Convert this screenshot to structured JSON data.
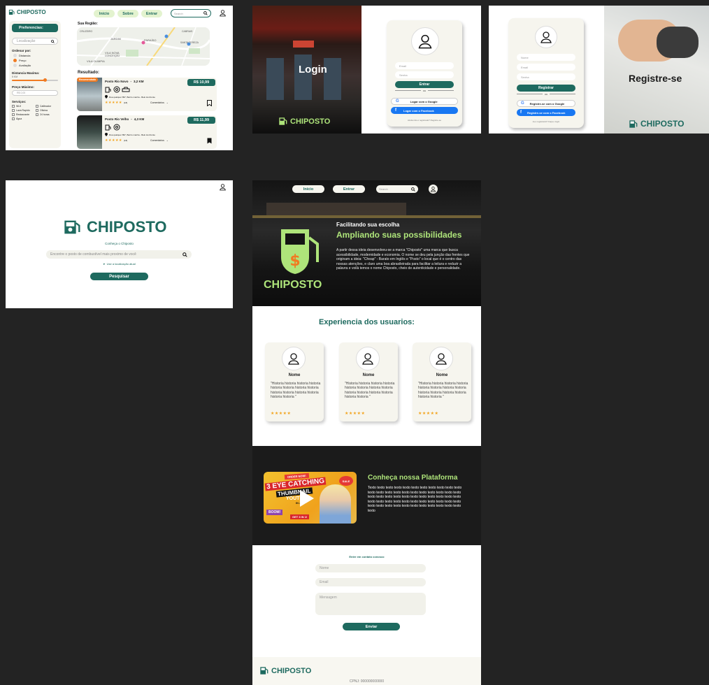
{
  "brand": "CHIPOSTO",
  "search_page": {
    "nav": [
      "Início",
      "Sobre",
      "Entrar"
    ],
    "search_placeholder": "Search",
    "prefs_title": "Preferencias:",
    "location_placeholder": "Localização",
    "sort_title": "Ordenar por:",
    "sort_options": [
      "Distancia",
      "Preço",
      "Avaliação"
    ],
    "distance_title": "Distancia Maxima:",
    "distance_value": "5 KM",
    "price_title": "Preço Máximo:",
    "price_placeholder": "R$ 0,00",
    "services_title": "Serviços:",
    "services": [
      "Wi-fi",
      "Calibrador",
      "Lava Rapido",
      "Oficina",
      "Restaurante",
      "24 horas",
      "Água"
    ],
    "region_title": "Sua Região:",
    "map_labels": [
      "CRUZEIRO",
      "JARDIM",
      "PARAÍSO",
      "SANTA TEREZA",
      "VILA NOVA",
      "CONCEIÇÃO",
      "VILA OLIMPIA",
      "CABRAIS"
    ],
    "results_title": "Resultado:",
    "recommended_badge": "Recomendado",
    "results": [
      {
        "name": "Posto Rio Novo",
        "dist": "3,2 KM",
        "price": "R$ 10,99",
        "address": "Rua qualquer 897, Bairro manha - Belo Horizonte",
        "reviews": "(18)",
        "comments": "Comentários"
      },
      {
        "name": "Posto Rio Velho",
        "dist": "4,3 KM",
        "price": "R$ 11,99",
        "address": "Rua qualquer 897, Bairro manha - Belo Horizonte",
        "reviews": "(18)",
        "comments": "Comentários"
      }
    ]
  },
  "login_page": {
    "title": "Login",
    "email_placeholder": "Email",
    "password_placeholder": "Senha",
    "submit": "Entrar",
    "or": "ou",
    "google": "Logar com o Google",
    "facebook": "Logar com o Facebook",
    "footer": "Ainda não é registrado? Registre-se"
  },
  "register_page": {
    "title": "Registre-se",
    "name_placeholder": "Nome",
    "email_placeholder": "Email",
    "password_placeholder": "Senha",
    "submit": "Registrar",
    "or": "ou",
    "google": "Registre-se com o Google",
    "facebook": "Registre-se com o Facebook",
    "footer": "Ja é registrado? Faça o login"
  },
  "home_page": {
    "brand": "CHIPOSTO",
    "know_link": "Conheça o Chiposto",
    "search_placeholder": "Encontre o posto de combustível mais proximo de você",
    "location_link": "Use a localização atual",
    "search_button": "Pesquisar"
  },
  "about_page": {
    "nav": [
      "Início",
      "Entrar"
    ],
    "search_placeholder": "Search",
    "hero_brand": "CHIPOSTO",
    "hero_sub": "Facilitando sua escolha",
    "hero_title": "Ampliando suas possibilidades",
    "hero_text": "A partir dessa ideia desenvolveu-se a marca \"Chiposto\" uma marca que busca acessibilidade, modernidade e economia. O nome se deu pela junção das frentes que originam a ideia: \"Cheap\" - Barato em Inglês e \"Posto\" o local que é o centro das nossas atenções, e claro uma boa abrasileirada para facilitar a leitura e reduzir a palavra e voilà temos o nome Chiposto, cheio de autenticidade e personalidade.",
    "reviews_title": "Experiencia dos usuarios:",
    "reviews": [
      {
        "name": "Nome",
        "text": "\"Historia historia historia historia historia historia historia historia historia historia historia historia historia historia \"",
        "stars": "★★★★★"
      },
      {
        "name": "Nome",
        "text": "\"Historia historia historia historia historia historia historia historia historia historia historia historia historia historia \"",
        "stars": "★★★★★"
      },
      {
        "name": "Nome",
        "text": "\"Historia historia historia historia historia historia historia historia historia historia historia historia historia historia \"",
        "stars": "★★★★★"
      }
    ],
    "thumb_top": "ORDER NOW!",
    "thumb_line1": "3 EYE CATCHING",
    "thumb_line2": "THUMBNAIL",
    "thumb_line3": "YOUTUBE",
    "thumb_line4": "IN 24 H",
    "thumb_sale": "SALE",
    "thumb_get": "GET 3 IN 1!",
    "thumb_boom": "BOOM!",
    "platform_title": "Conheça nossa Plataforma",
    "platform_text": "Texto texto texto texto texto texto texto texto texto texto texto texto texto texto texto texto texto texto texto texto texto texto texto texto texto texto texto texto texto texto texto texto texto texto texto texto texto texto texto texto texto texto texto texto texto texto texto texto texto texto texto texto texto texto texto texto",
    "contact_link": "Entre em contato conosco",
    "contact_name": "Nome",
    "contact_email": "Email",
    "contact_message": "Mensagem",
    "contact_submit": "Enviar",
    "footer_brand": "CHIPOSTO",
    "footer_cnpj": "CPNJ: 000000000000"
  },
  "colors": {
    "brand_green": "#1e6a5f",
    "light_green": "#aee47a",
    "cream": "#f6f5ee",
    "orange": "#f07b22"
  }
}
